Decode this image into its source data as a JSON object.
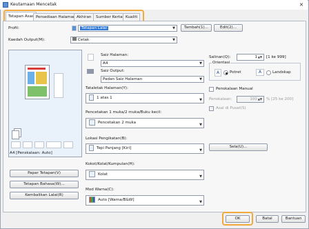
{
  "window": {
    "title": "Keutamaan Mencetak",
    "close_glyph": "×"
  },
  "tabs": [
    {
      "label": "Tetapan Asas"
    },
    {
      "label": "Persediaan Halaman"
    },
    {
      "label": "Akhiran"
    },
    {
      "label": "Sumber Kertas"
    },
    {
      "label": "Kualiti"
    }
  ],
  "profile": {
    "label": "Profil:",
    "value": "Tetapan Lalai",
    "add_button": "Tambah(1)...",
    "edit_button": "Edit(2)..."
  },
  "output_method": {
    "label": "Kaedah Output(M):",
    "value": "Cetak"
  },
  "preview": {
    "status": "A4 [Penskalaan: Auto]"
  },
  "left_buttons": {
    "view_settings": "Papar Tetapan(V)",
    "language_settings": "Tetapan Bahasa(W)...",
    "restore_defaults": "Kembalikan Lalai(R)"
  },
  "page_size": {
    "label": "Saiz Halaman:",
    "value": "A4"
  },
  "output_size": {
    "label": "Saiz Output:",
    "value": "Padan Saiz Halaman"
  },
  "page_layout": {
    "label": "Tataletak Halaman(Y):",
    "value": "1 atas 1"
  },
  "duplex": {
    "label": "Pencetakan 1 muka/2 muka/Buku kecil:",
    "value": "Pencetakan 2 muka"
  },
  "binding": {
    "label": "Lokasi Pengikatan(B):",
    "value": "Tepi Panjang [Kiri]",
    "gutter_button": "Sela(U)..."
  },
  "collate": {
    "label": "Kokot/Kolat/Kumpulan(H):",
    "value": "Kolat"
  },
  "color_mode": {
    "label": "Mod Warna(C):",
    "value": "Auto [Warna/B&W]"
  },
  "copies": {
    "label": "Salinan(Q):",
    "value": "1",
    "range": "[1 ke 999]"
  },
  "orientation": {
    "label": "Orientasi",
    "portrait": "Potret",
    "landscape": "Landskap",
    "selected": "portrait"
  },
  "manual_scaling": {
    "label": "Penskalaan Manual",
    "scaling_label": "Penskalaan:",
    "scaling_value": "100",
    "scaling_range": "% [25 ke 200]",
    "from_center": "Asal di Pusat(S)"
  },
  "footer": {
    "ok": "OK",
    "cancel": "Batal",
    "help": "Bantuan"
  },
  "colors": {
    "highlight": "#f2a93b",
    "accent": "#3279d8"
  }
}
